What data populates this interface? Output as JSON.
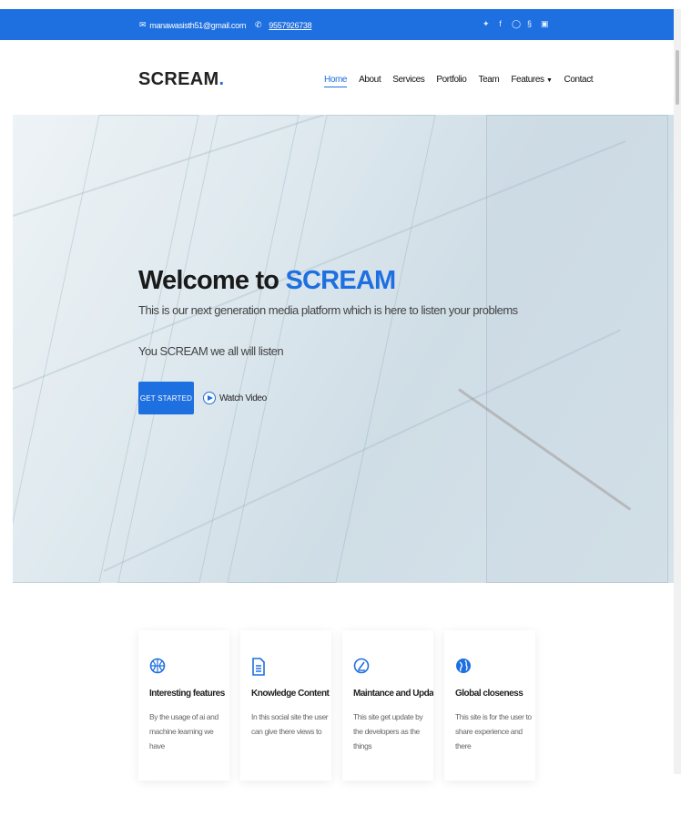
{
  "topbar": {
    "email": "manawasisth51@gmail.com",
    "phone": "9557926738",
    "social_icons": [
      "twitter-icon",
      "facebook-icon",
      "instagram-icon",
      "skype-icon",
      "linkedin-icon"
    ],
    "bg_color": "#1e6fe0"
  },
  "brand": {
    "name": "SCREAM",
    "dot": "."
  },
  "nav": {
    "items": [
      "Home",
      "About",
      "Services",
      "Portfolio",
      "Team",
      "Features",
      "Contact"
    ],
    "active": "Home",
    "dropdown_item": "Features"
  },
  "hero": {
    "title_prefix": "Welcome to ",
    "title_brand": "SCREAM",
    "subtitle": "This is our next generation media platform which is here to listen your problems",
    "tagline": "You SCREAM we all will listen",
    "cta_label": "GET STARTED",
    "watch_label": "Watch Video"
  },
  "features": [
    {
      "icon": "basketball-icon",
      "title": "Interesting features",
      "desc": "By the usage of ai and machine learning we have"
    },
    {
      "icon": "document-icon",
      "title": "Knowledge Content",
      "desc": "In this social site the user can give there views to"
    },
    {
      "icon": "speedometer-icon",
      "title": "Maintance and Updates",
      "desc": "This site get update by the developers as the things"
    },
    {
      "icon": "globe-icon",
      "title": "Global closeness",
      "desc": "This site is for the user to share experience and there"
    }
  ],
  "accent_color": "#1e6fe0"
}
